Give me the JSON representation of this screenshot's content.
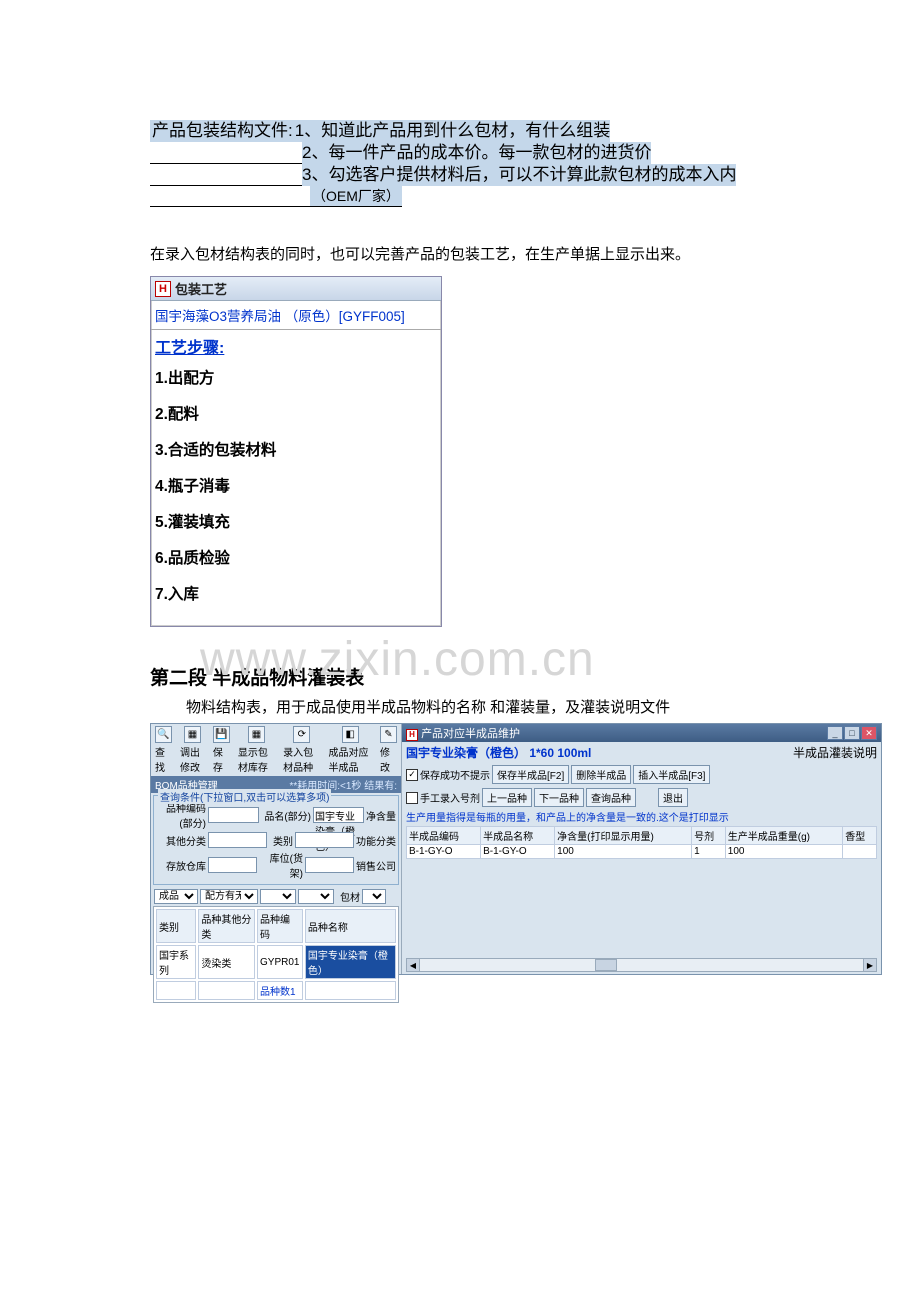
{
  "header": {
    "title_prefix": "产品包装结构文件:",
    "line1_num": "1、",
    "line1_text": "知道此产品用到什么包材，有什么组装",
    "line2_num": "2、",
    "line2_text": "每一件产品的成本价。每一款包材的进货价",
    "line3_num": "3、",
    "line3_text": "勾选客户提供材料后，可以不计算此款包材的成本入内",
    "oem_text": "（OEM厂家）"
  },
  "para1": "在录入包材结构表的同时，也可以完善产品的包装工艺，在生产单据上显示出来。",
  "card": {
    "icon_text": "H",
    "title": "包装工艺",
    "subtitle": "国宇海藻O3营养局油 （原色）[GYFF005]",
    "section_label": "工艺步骤:",
    "steps": [
      "1.出配方",
      "2.配料",
      "3.合适的包装材料",
      "4.瓶子消毒",
      "5.灌装填充",
      "6.品质检验",
      "7.入库"
    ]
  },
  "watermark": "www.zixin.com.cn",
  "section2": {
    "title": "第二段  半成品物料灌装表",
    "desc": "物料结构表，用于成品使用半成品物料的名称 和灌装量，及灌装说明文件"
  },
  "app": {
    "left": {
      "toolbar": [
        {
          "icon": "🔍",
          "label": "查找"
        },
        {
          "icon": "▦",
          "label": "调出修改"
        },
        {
          "icon": "💾",
          "label": "保存"
        },
        {
          "icon": "▦",
          "label": "显示包材库存"
        },
        {
          "icon": "⟳",
          "label": "录入包材品种"
        },
        {
          "icon": "◧",
          "label": "成品对应半成品"
        },
        {
          "icon": "✎",
          "label": "修改"
        }
      ],
      "tab_label": "BOM品种管理",
      "tab_hint": "**耗用时间:<1秒 结果有:",
      "query_legend": "查询条件(下拉窗口,双击可以选算多项)",
      "labels": {
        "code": "品种编码(部分)",
        "name_lbl": "品名(部分)",
        "name_val": "国宇专业染膏（橙色）",
        "net": "净含量",
        "other": "其他分类",
        "category": "类别",
        "func": "功能分类",
        "store": "存放仓库",
        "loc": "库位(货架)",
        "sales": "销售公司"
      },
      "sel_row": {
        "l1": "成品",
        "l2": "配方有无",
        "l3": "包材"
      },
      "table": {
        "cols": [
          "类别",
          "品种其他分类",
          "品种编码",
          "品种名称"
        ],
        "row": [
          "国宇系列",
          "烫染类",
          "GYPR01",
          "国宇专业染膏（橙色）"
        ],
        "summary_label": "品种数1"
      }
    },
    "right": {
      "title": "产品对应半成品维护",
      "subtitle": "国宇专业染膏（橙色） 1*60  100ml",
      "side_label": "半成品灌装说明",
      "chk_save_tip": "保存成功不提示",
      "btn_save": "保存半成品[F2]",
      "btn_del": "删除半成品",
      "btn_ins": "插入半成品[F3]",
      "chk_manual": "手工录入号剂",
      "btn_prev": "上一品种",
      "btn_next": "下一品种",
      "btn_query": "查询品种",
      "btn_exit": "退出",
      "note": "生产用量指得是每瓶的用量，和产品上的净含量是一致的.这个是打印显示",
      "table": {
        "cols": [
          "半成品编码",
          "半成品名称",
          "净含量(打印显示用量)",
          "号剂",
          "生产半成品重量(g)",
          "香型"
        ],
        "row": [
          "B-1-GY-O",
          "B-1-GY-O",
          "100",
          "1",
          "100",
          ""
        ]
      }
    }
  }
}
